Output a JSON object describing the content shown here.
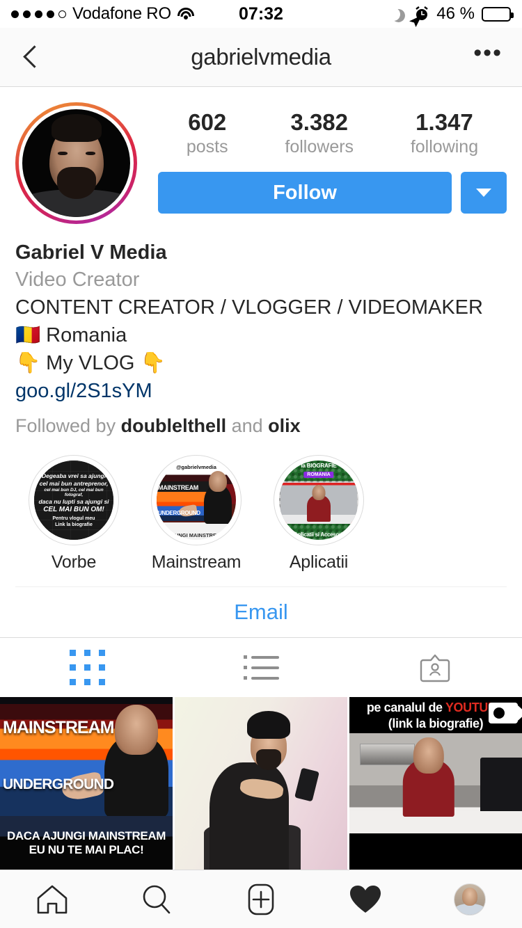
{
  "status_bar": {
    "signal_dots_filled": 4,
    "signal_dots_total": 5,
    "carrier": "Vodafone RO",
    "wifi_icon": "wifi-icon",
    "time": "07:32",
    "moon_icon": "moon-icon",
    "location_icon": "location-arrow-icon",
    "alarm_icon": "alarm-clock-icon",
    "battery_percent": "46 %",
    "battery_fill_color": "#ffcc00",
    "battery_level": 46
  },
  "nav": {
    "back_icon": "back-chevron-icon",
    "title": "gabrielvmedia",
    "more_icon": "more-options-icon",
    "more_label": "•••"
  },
  "profile": {
    "avatar_has_story_ring": true,
    "story_ring_colors": [
      "#f09433",
      "#e6683c",
      "#dc2743",
      "#cc2366",
      "#a02bc0"
    ],
    "stats": [
      {
        "value": "602",
        "label": "posts"
      },
      {
        "value": "3.382",
        "label": "followers"
      },
      {
        "value": "1.347",
        "label": "following"
      }
    ],
    "follow_button": {
      "label": "Follow",
      "color": "#3897f0"
    },
    "dropdown_icon": "chevron-down-icon",
    "name": "Gabriel V Media",
    "category": "Video Creator",
    "bio_lines": [
      "CONTENT CREATOR / VLOGGER / VIDEOMAKER",
      "🇷🇴  Romania",
      "👇  My VLOG  👇"
    ],
    "website": "goo.gl/2S1sYM",
    "website_color": "#003569",
    "followed_by_prefix": "Followed by ",
    "followed_by_user1": "doublelthell",
    "followed_by_mid": " and ",
    "followed_by_user2": "olix"
  },
  "highlights": [
    {
      "label": "Vorbe",
      "cover_text": {
        "l1": "Degeaba vrei sa ajungi",
        "l2": "cel mai bun antreprenor,",
        "l3": "cel mai bun DJ, cel mai bun fotograf,",
        "l4": "daca nu lupti sa ajungi si",
        "l5": "CEL MAI BUN OM!",
        "l6": "Pentru vlogul meu\nLink la biografie"
      }
    },
    {
      "label": "Mainstream",
      "cover_text": {
        "handle": "@gabrielvmedia",
        "main": "MAINSTREAM",
        "sub": "UNDERGROUND",
        "bottom": "AJUNGI MAINSTREAM"
      }
    },
    {
      "label": "Aplicatii",
      "cover_text": {
        "top": "la BIOGRAFIE",
        "badge": "ROMANIA",
        "bottom": "Aplicatii si Accesorii"
      }
    }
  ],
  "contact": {
    "email_label": "Email",
    "email_color": "#3897f0"
  },
  "tabs": [
    {
      "name": "grid-tab",
      "icon": "grid-icon",
      "active": true,
      "active_color": "#3897f0"
    },
    {
      "name": "list-tab",
      "icon": "list-icon",
      "active": false
    },
    {
      "name": "tagged-tab",
      "icon": "tagged-photos-icon",
      "active": false
    }
  ],
  "grid_posts": [
    {
      "id": "post-1",
      "overlay_title": "MAINSTREAM",
      "overlay_sub": "UNDERGROUND",
      "caption_line1": "DACA AJUNGI MAINSTREAM",
      "caption_line2": "EU NU TE MAI PLAC!"
    },
    {
      "id": "post-2",
      "description": "person with beanie sitting looking at phone"
    },
    {
      "id": "post-3",
      "header_line1_a": "pe canalul de ",
      "header_line1_b": "YOUTUBE",
      "header_line2": "(link la biografie)",
      "youtube_color": "#e02b20"
    }
  ],
  "bottom_nav": [
    {
      "name": "home-tab",
      "icon": "home-icon"
    },
    {
      "name": "search-tab",
      "icon": "search-icon"
    },
    {
      "name": "add-post-tab",
      "icon": "plus-square-icon"
    },
    {
      "name": "activity-tab",
      "icon": "heart-filled-icon"
    },
    {
      "name": "profile-tab",
      "icon": "profile-avatar-icon"
    }
  ]
}
